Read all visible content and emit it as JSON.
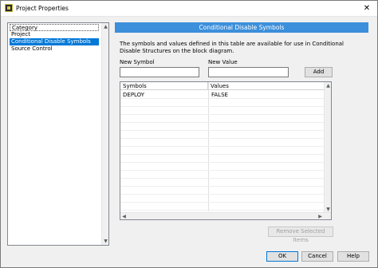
{
  "window": {
    "title": "Project Properties",
    "close_glyph": "✕"
  },
  "sidebar": {
    "header": "Category",
    "items": [
      {
        "label": "Project",
        "selected": false
      },
      {
        "label": "Conditional Disable Symbols",
        "selected": true
      },
      {
        "label": "Source Control",
        "selected": false
      }
    ]
  },
  "main": {
    "banner": "Conditional Disable Symbols",
    "description": "The symbols and values defined in this table are available for use in Conditional Disable Structures on the block diagram.",
    "new_symbol_label": "New Symbol",
    "new_symbol_value": "",
    "new_value_label": "New Value",
    "new_value_value": "",
    "add_label": "Add",
    "table": {
      "columns": [
        "Symbols",
        "Values"
      ],
      "rows": [
        {
          "symbol": "DEPLOY",
          "value": "FALSE"
        }
      ]
    },
    "remove_label": "Remove Selected Items"
  },
  "footer": {
    "ok": "OK",
    "cancel": "Cancel",
    "help": "Help"
  },
  "colors": {
    "accent": "#0078d7",
    "banner": "#3c8fdb"
  },
  "icons": {
    "app": "labview-project-icon",
    "scroll_up": "▲",
    "scroll_down": "▼",
    "scroll_left": "◀",
    "scroll_right": "▶"
  }
}
